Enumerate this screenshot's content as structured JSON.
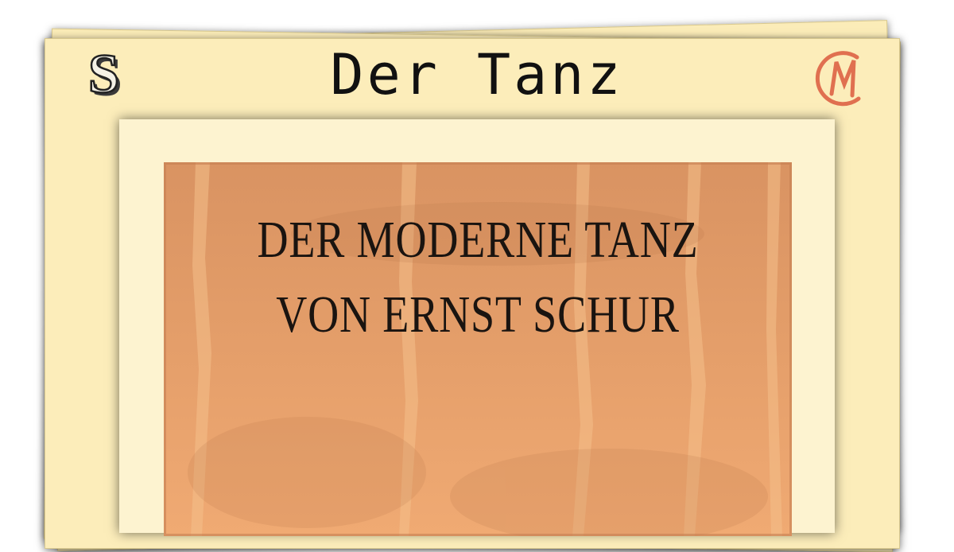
{
  "header": {
    "title": "Der Tanz",
    "left_logo": {
      "icon": "ornate-s-logo-icon",
      "letter": "S"
    },
    "right_logo": {
      "icon": "cm-monogram-logo-icon",
      "letters": "CM",
      "color": "#e07050"
    }
  },
  "cover": {
    "line1": "DER MODERNE TANZ",
    "line2": "VON ERNST SCHUR",
    "colors": {
      "paper": "#e39c68",
      "ink": "#1a1410"
    }
  }
}
